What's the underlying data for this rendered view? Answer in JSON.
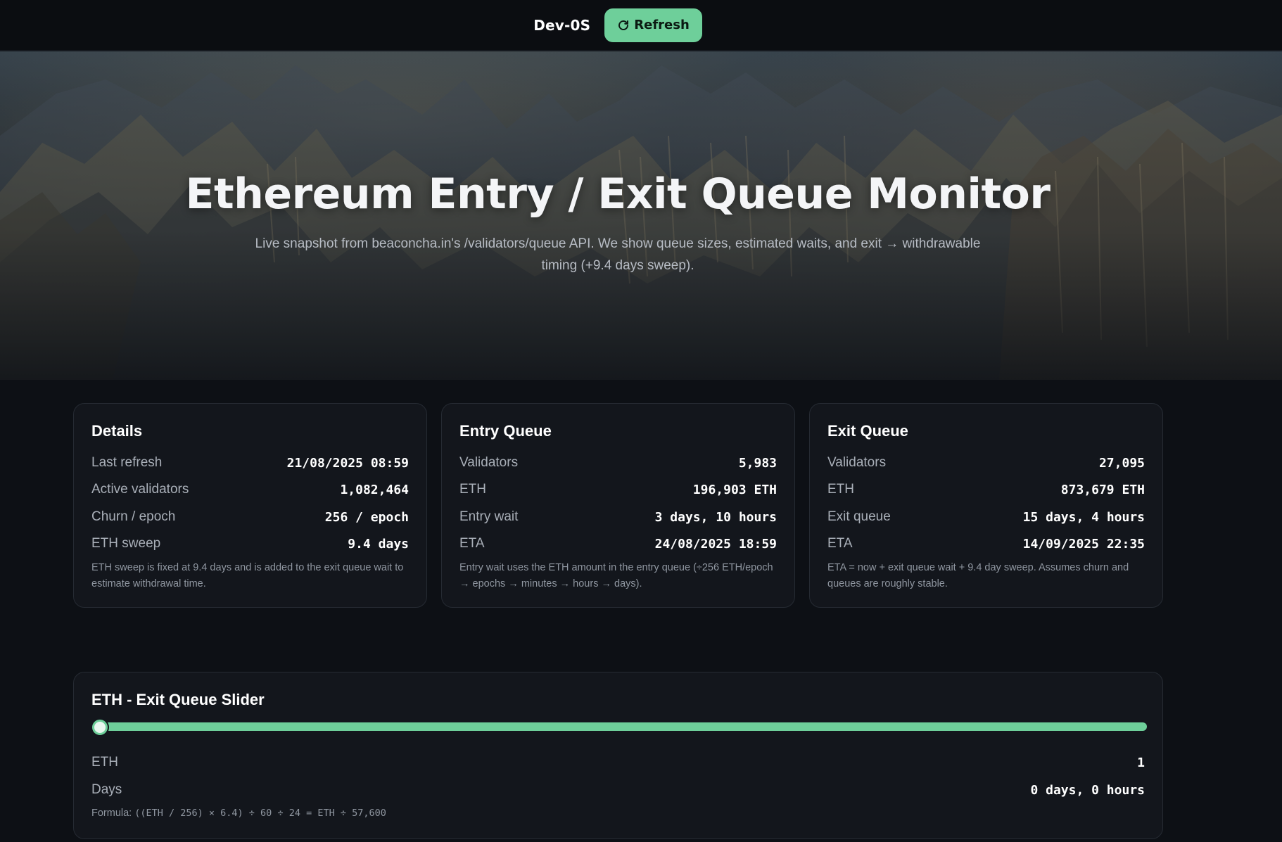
{
  "colors": {
    "accent": "#6ecf9a",
    "background": "#0d1015",
    "card": "#13161c"
  },
  "topbar": {
    "brand": "Dev-0S",
    "refresh_label": "Refresh",
    "refresh_icon": "refresh-icon"
  },
  "hero": {
    "title": "Ethereum Entry / Exit Queue Monitor",
    "subtitle": "Live snapshot from beaconcha.in's /validators/queue API. We show queue sizes, estimated waits, and exit → withdrawable timing (+9.4 days sweep)."
  },
  "details": {
    "title": "Details",
    "rows": [
      {
        "label": "Last refresh",
        "value": "21/08/2025 08:59"
      },
      {
        "label": "Active validators",
        "value": "1,082,464"
      },
      {
        "label": "Churn / epoch",
        "value": "256 / epoch"
      },
      {
        "label": "ETH sweep",
        "value": "9.4 days"
      }
    ],
    "note": "ETH sweep is fixed at 9.4 days and is added to the exit queue wait to estimate withdrawal time."
  },
  "entry_queue": {
    "title": "Entry Queue",
    "rows": [
      {
        "label": "Validators",
        "value": "5,983"
      },
      {
        "label": "ETH",
        "value": "196,903 ETH"
      },
      {
        "label": "Entry wait",
        "value": "3 days, 10 hours"
      },
      {
        "label": "ETA",
        "value": "24/08/2025 18:59"
      }
    ],
    "note": "Entry wait uses the ETH amount in the entry queue (÷256 ETH/epoch → epochs → minutes → hours → days)."
  },
  "exit_queue": {
    "title": "Exit Queue",
    "rows": [
      {
        "label": "Validators",
        "value": "27,095"
      },
      {
        "label": "ETH",
        "value": "873,679 ETH"
      },
      {
        "label": "Exit queue",
        "value": "15 days, 4 hours"
      },
      {
        "label": "ETA",
        "value": "14/09/2025 22:35"
      }
    ],
    "note": "ETA = now + exit queue wait + 9.4 day sweep. Assumes churn and queues are roughly stable."
  },
  "slider": {
    "title": "ETH - Exit Queue Slider",
    "position_fraction": 0,
    "eth_label": "ETH",
    "eth_value": "1",
    "days_label": "Days",
    "days_value": "0 days, 0 hours",
    "formula_prefix": "Formula:",
    "formula": "((ETH / 256) × 6.4) ÷ 60 ÷ 24 = ETH ÷ 57,600"
  }
}
